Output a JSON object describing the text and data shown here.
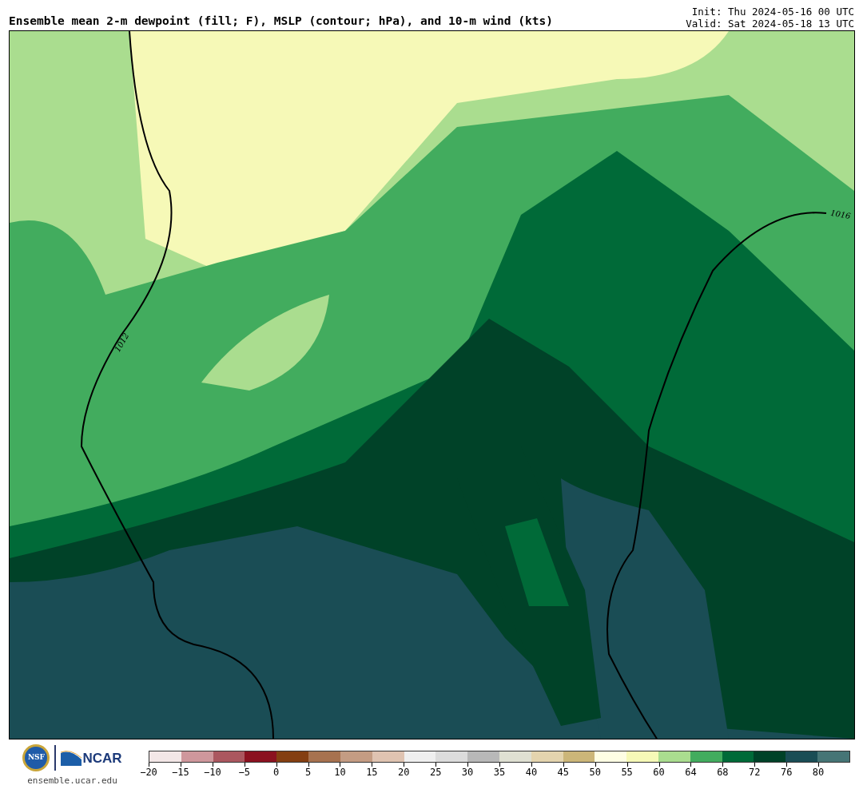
{
  "title": "Ensemble mean 2-m dewpoint (fill; F), MSLP (contour; hPa), and 10-m wind (kts)",
  "init": "Init: Thu 2024-05-16 00 UTC",
  "valid": "Valid: Sat 2024-05-18 13 UTC",
  "map": {
    "contour_labels": [
      "1012",
      "1016"
    ]
  },
  "footer": {
    "logo_left": "NSF",
    "logo_right": "NCAR",
    "url": "ensemble.ucar.edu"
  },
  "colorbar": {
    "bins": [
      {
        "label": "−20",
        "color": "#f3e7e7"
      },
      {
        "label": "−15",
        "color": "#cf979c"
      },
      {
        "label": "−10",
        "color": "#ab575f"
      },
      {
        "label": "−5",
        "color": "#8b1220"
      },
      {
        "label": "0",
        "color": "#843f12"
      },
      {
        "label": "5",
        "color": "#a7724f"
      },
      {
        "label": "10",
        "color": "#c49c83"
      },
      {
        "label": "15",
        "color": "#dfc3b1"
      },
      {
        "label": "20",
        "color": "#efefef"
      },
      {
        "label": "25",
        "color": "#dcdcdc"
      },
      {
        "label": "30",
        "color": "#b8b8b8"
      },
      {
        "label": "35",
        "color": "#dfe0d2"
      },
      {
        "label": "40",
        "color": "#e4d4ae"
      },
      {
        "label": "45",
        "color": "#ccb679"
      },
      {
        "label": "50",
        "color": "#fefee4"
      },
      {
        "label": "55",
        "color": "#f6f9b7"
      },
      {
        "label": "60",
        "color": "#aadd8f"
      },
      {
        "label": "64",
        "color": "#42ac5e"
      },
      {
        "label": "68",
        "color": "#006a38"
      },
      {
        "label": "72",
        "color": "#004228"
      },
      {
        "label": "76",
        "color": "#1a4d55"
      },
      {
        "label": "80",
        "color": "#467576"
      }
    ]
  }
}
